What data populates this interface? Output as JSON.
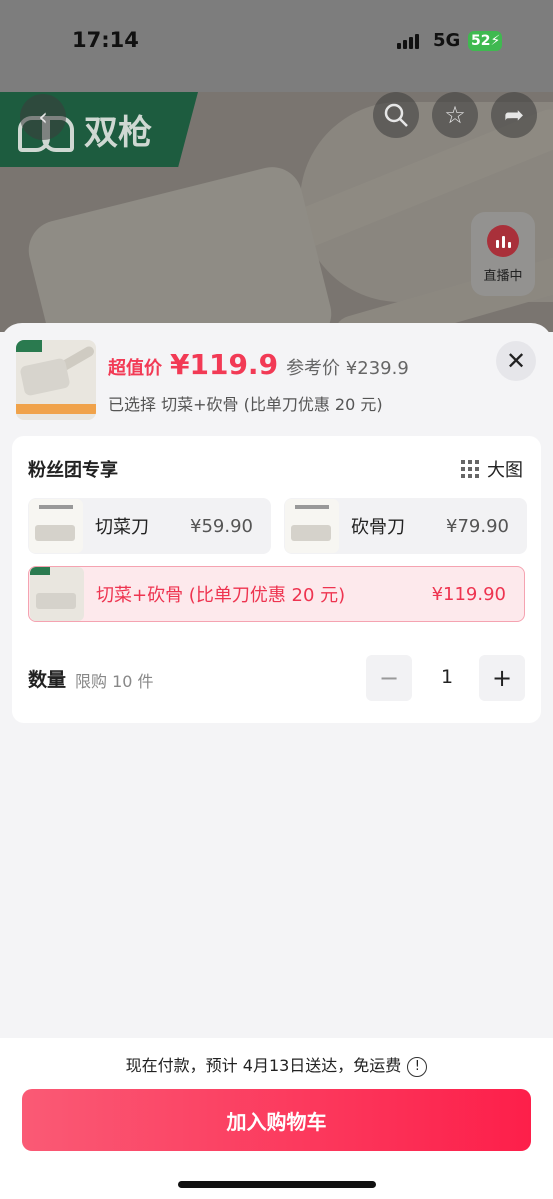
{
  "status_bar": {
    "time": "17:14",
    "network": "5G",
    "battery": "52"
  },
  "hero": {
    "brand_name": "双枪",
    "live_label": "直播中"
  },
  "header": {
    "price_label": "超值价",
    "price": "¥119.9",
    "reference_price": "参考价 ¥239.9",
    "selected": "已选择 切菜+砍骨 (比单刀优惠 20 元)"
  },
  "options_section": {
    "title": "粉丝团专享",
    "big_picture_label": "大图",
    "options": [
      {
        "name": "切菜刀",
        "price": "¥59.90",
        "selected": false
      },
      {
        "name": "砍骨刀",
        "price": "¥79.90",
        "selected": false
      },
      {
        "name": "切菜+砍骨 (比单刀优惠 20 元)",
        "price": "¥119.90",
        "selected": true
      }
    ]
  },
  "quantity": {
    "label": "数量",
    "limit": "限购 10 件",
    "value": "1",
    "minus": "−",
    "plus": "+"
  },
  "footer": {
    "delivery": "现在付款，预计 4月13日送达，免运费",
    "add_to_cart": "加入购物车"
  },
  "colors": {
    "accent": "#f23a55",
    "button": "#fd3a5c",
    "brand_green": "#1d5c3f"
  }
}
